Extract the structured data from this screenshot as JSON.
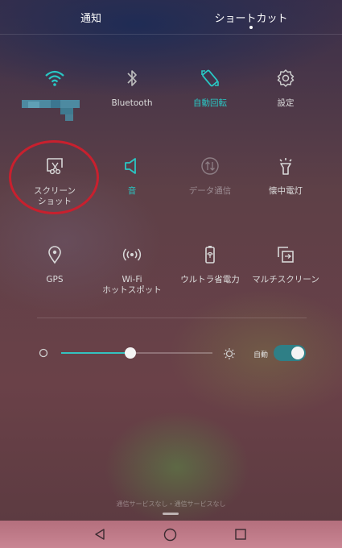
{
  "tabs": {
    "notifications": "通知",
    "shortcuts": "ショートカット"
  },
  "tiles": [
    {
      "id": "wifi",
      "label": "",
      "icon": "wifi-icon",
      "state": "active"
    },
    {
      "id": "bluetooth",
      "label": "Bluetooth",
      "icon": "bluetooth-icon",
      "state": "inactive"
    },
    {
      "id": "auto-rotate",
      "label": "自動回転",
      "icon": "rotate-icon",
      "state": "active"
    },
    {
      "id": "settings",
      "label": "設定",
      "icon": "gear-icon",
      "state": "inactive"
    },
    {
      "id": "screenshot",
      "label": "スクリーン\nショット",
      "icon": "screenshot-icon",
      "state": "inactive"
    },
    {
      "id": "sound",
      "label": "音",
      "icon": "speaker-icon",
      "state": "active"
    },
    {
      "id": "data",
      "label": "データ通信",
      "icon": "data-transfer-icon",
      "state": "disabled"
    },
    {
      "id": "flashlight",
      "label": "懐中電灯",
      "icon": "flashlight-icon",
      "state": "inactive"
    },
    {
      "id": "gps",
      "label": "GPS",
      "icon": "location-pin-icon",
      "state": "inactive"
    },
    {
      "id": "hotspot",
      "label": "Wi-Fi\nホットスポット",
      "icon": "hotspot-icon",
      "state": "inactive"
    },
    {
      "id": "ultra-power",
      "label": "ウルトラ省電力",
      "icon": "battery-leaf-icon",
      "state": "inactive"
    },
    {
      "id": "multiscreen",
      "label": "マルチスクリーン",
      "icon": "multiscreen-icon",
      "state": "inactive"
    }
  ],
  "brightness": {
    "level": 0.46,
    "auto_label": "自動",
    "auto_enabled": true
  },
  "footer": {
    "status_text": "通信サービスなし・通信サービスなし"
  },
  "navbar": {
    "back": "back-icon",
    "home": "home-icon",
    "recents": "recents-icon"
  },
  "colors": {
    "accent": "#29c7c4",
    "annotation_circle": "#c8202e",
    "navbar": "#c07a88"
  }
}
